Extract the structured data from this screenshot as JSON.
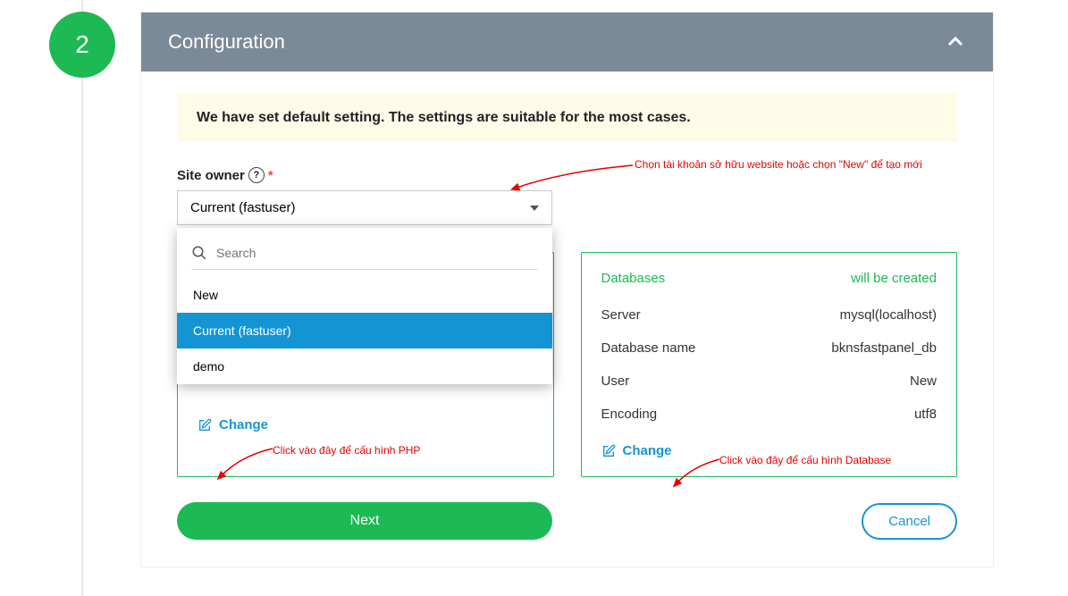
{
  "step": "2",
  "header": {
    "title": "Configuration"
  },
  "banner": "We have set default setting. The settings are suitable for the most cases.",
  "siteOwner": {
    "label": "Site owner",
    "required": "*",
    "selected": "Current (fastuser)",
    "searchPlaceholder": "Search",
    "options": [
      "New",
      "Current (fastuser)",
      "demo"
    ]
  },
  "phpCard": {
    "changeLabel": "Change"
  },
  "dbCard": {
    "title": "Databases",
    "status": "will be created",
    "serverLabel": "Server",
    "serverValue": "mysql(localhost)",
    "dbNameLabel": "Database name",
    "dbNameValue": "bknsfastpanel_db",
    "userLabel": "User",
    "userValue": "New",
    "encodingLabel": "Encoding",
    "encodingValue": "utf8",
    "changeLabel": "Change"
  },
  "actions": {
    "next": "Next",
    "cancel": "Cancel"
  },
  "annotations": {
    "owner": "Chọn tài khoản sở hữu website hoặc chọn \"New\" để tạo mới",
    "php": "Click vào đây để cấu hình PHP",
    "db": "Click vào đây để cấu hình Database"
  }
}
